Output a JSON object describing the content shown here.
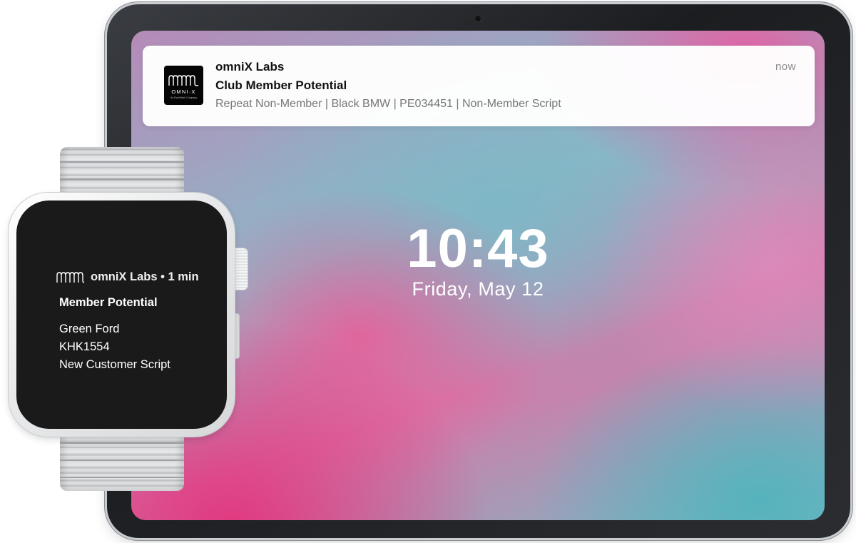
{
  "ipad": {
    "notification": {
      "app_name": "omniX Labs",
      "title": "Club Member Potential",
      "body": "Repeat Non-Member | Black BMW | PE034451 | Non-Member Script",
      "time": "now",
      "logo": {
        "icon": "omnix-wave-logo-icon",
        "text": "OMNI·X",
        "subtext": "An EverWash Company"
      }
    },
    "lock_screen": {
      "time": "10:43",
      "date": "Friday, May 12"
    },
    "colors": {
      "wallpaper_pink": "#e2377f",
      "wallpaper_teal": "#55b3bd",
      "wallpaper_blue": "#7eb7c6"
    }
  },
  "watch": {
    "notification": {
      "header": "omniX Labs • 1 min",
      "title": "Member Potential",
      "lines": [
        "Green Ford",
        "KHK1554",
        "New Customer Script"
      ],
      "icon": "omnix-wave-logo-icon"
    }
  }
}
